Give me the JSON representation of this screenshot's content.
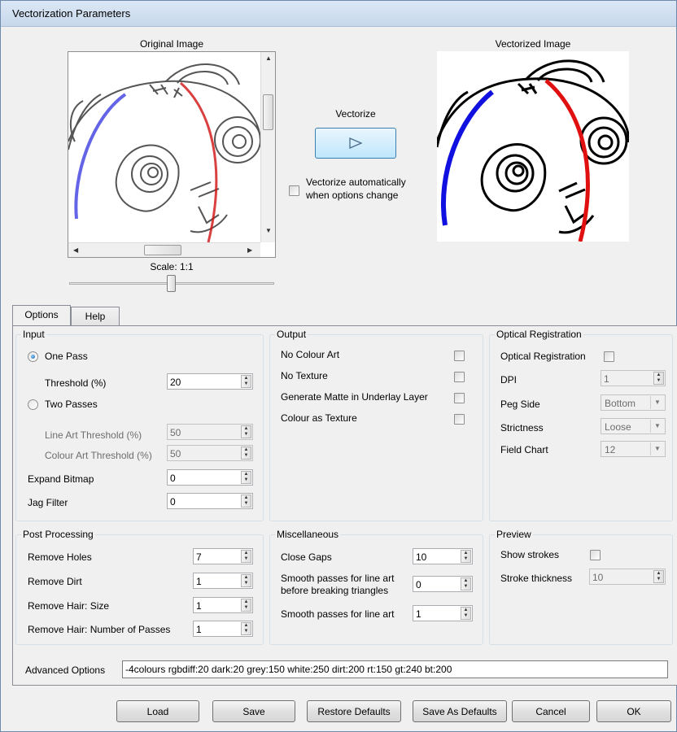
{
  "window": {
    "title": "Vectorization Parameters"
  },
  "preview": {
    "original_label": "Original Image",
    "vectorized_label": "Vectorized Image",
    "vectorize_label": "Vectorize",
    "auto_vectorize_label_line1": "Vectorize automatically",
    "auto_vectorize_label_line2": "when options change",
    "auto_vectorize_checked": false,
    "scale_label": "Scale: 1:1"
  },
  "tabs": [
    {
      "label": "Options",
      "active": true
    },
    {
      "label": "Help",
      "active": false
    }
  ],
  "input": {
    "title": "Input",
    "one_pass_label": "One Pass",
    "one_pass_selected": true,
    "threshold_label": "Threshold (%)",
    "threshold_value": "20",
    "two_passes_label": "Two Passes",
    "two_passes_selected": false,
    "line_art_threshold_label": "Line Art Threshold (%)",
    "line_art_threshold_value": "50",
    "colour_art_threshold_label": "Colour Art Threshold (%)",
    "colour_art_threshold_value": "50",
    "expand_bitmap_label": "Expand Bitmap",
    "expand_bitmap_value": "0",
    "jag_filter_label": "Jag Filter",
    "jag_filter_value": "0"
  },
  "output": {
    "title": "Output",
    "no_colour_art_label": "No Colour Art",
    "no_texture_label": "No Texture",
    "generate_matte_label": "Generate Matte in Underlay Layer",
    "colour_as_texture_label": "Colour as Texture"
  },
  "optical_registration": {
    "title": "Optical Registration",
    "enable_label": "Optical Registration",
    "dpi_label": "DPI",
    "dpi_value": "1",
    "peg_side_label": "Peg Side",
    "peg_side_value": "Bottom",
    "strictness_label": "Strictness",
    "strictness_value": "Loose",
    "field_chart_label": "Field Chart",
    "field_chart_value": "12"
  },
  "post_processing": {
    "title": "Post Processing",
    "remove_holes_label": "Remove Holes",
    "remove_holes_value": "7",
    "remove_dirt_label": "Remove Dirt",
    "remove_dirt_value": "1",
    "remove_hair_size_label": "Remove Hair: Size",
    "remove_hair_size_value": "1",
    "remove_hair_passes_label": "Remove Hair: Number of Passes",
    "remove_hair_passes_value": "1"
  },
  "miscellaneous": {
    "title": "Miscellaneous",
    "close_gaps_label": "Close Gaps",
    "close_gaps_value": "10",
    "smooth_breaking_label_line1": "Smooth passes for line art",
    "smooth_breaking_label_line2": "before breaking triangles",
    "smooth_breaking_value": "0",
    "smooth_line_art_label": "Smooth passes for line art",
    "smooth_line_art_value": "1"
  },
  "preview_group": {
    "title": "Preview",
    "show_strokes_label": "Show strokes",
    "stroke_thickness_label": "Stroke thickness",
    "stroke_thickness_value": "10"
  },
  "advanced": {
    "label": "Advanced Options",
    "value": "-4colours rgbdiff:20 dark:20 grey:150 white:250 dirt:200 rt:150 gt:240 bt:200"
  },
  "buttons": {
    "load": "Load",
    "save": "Save",
    "restore_defaults": "Restore Defaults",
    "save_as_defaults": "Save As Defaults",
    "cancel": "Cancel",
    "ok": "OK"
  },
  "colors": {
    "accent_red": "#e01010",
    "accent_blue": "#1010e0"
  }
}
